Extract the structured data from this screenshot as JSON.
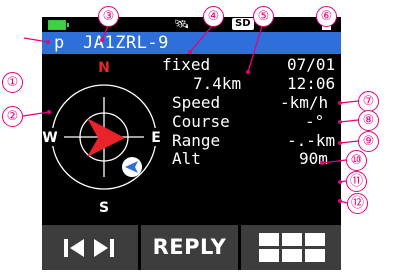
{
  "status": {
    "battery_icon": "battery-icon",
    "gps_icon": "satellite-icon",
    "sd_label": "SD",
    "memory_icon": "document-icon"
  },
  "station": {
    "symbol": "p",
    "callsign": "JA1ZRL-9"
  },
  "compass": {
    "north": "N",
    "south": "S",
    "east": "E",
    "west": "W",
    "colors": {
      "ring": "#ffffff",
      "arrow": "#e8232a",
      "cardinal_north": "#e8232a",
      "target": "#2e6fd9"
    }
  },
  "info": {
    "status": "fixed",
    "date": "07/01",
    "distance": "7.4km",
    "time": "12:06",
    "speed_label": "Speed",
    "speed_value": "-km/h",
    "course_label": "Course",
    "course_value": "-°",
    "range_label": "Range",
    "range_value": "-.-km",
    "alt_label": "Alt",
    "alt_value": "90m"
  },
  "buttons": {
    "prev_next_icon": "skip-prev-next-icon",
    "reply_label": "REPLY",
    "menu_icon": "grid-menu-icon"
  },
  "callouts": [
    "①",
    "②",
    "③",
    "④",
    "⑤",
    "⑥",
    "⑦",
    "⑧",
    "⑨",
    "⑩",
    "⑪",
    "⑫"
  ],
  "accent_color": "#e6007e"
}
